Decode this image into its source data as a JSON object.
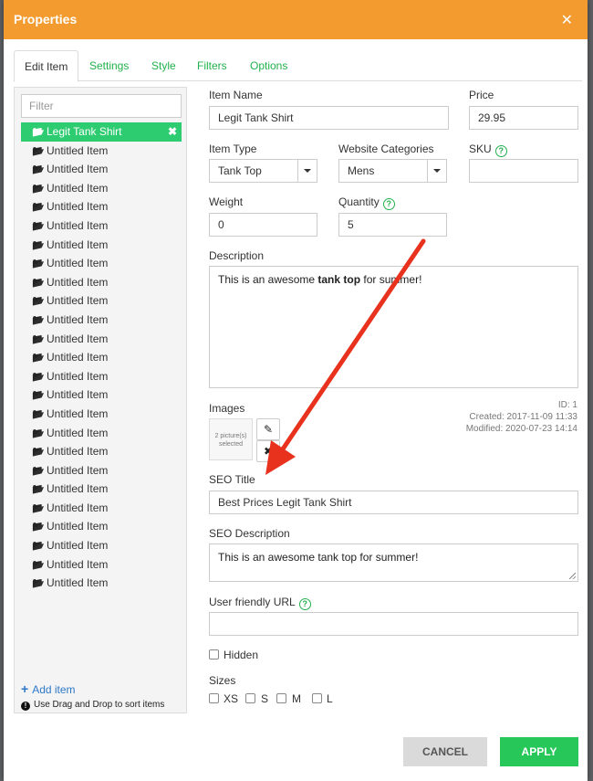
{
  "dialog": {
    "title": "Properties",
    "close_glyph": "✕"
  },
  "tabs": [
    {
      "label": "Edit Item"
    },
    {
      "label": "Settings"
    },
    {
      "label": "Style"
    },
    {
      "label": "Filters"
    },
    {
      "label": "Options"
    }
  ],
  "sidebar": {
    "filter_placeholder": "Filter",
    "items": [
      {
        "label": "Legit Tank Shirt"
      },
      {
        "label": "Untitled Item"
      },
      {
        "label": "Untitled Item"
      },
      {
        "label": "Untitled Item"
      },
      {
        "label": "Untitled Item"
      },
      {
        "label": "Untitled Item"
      },
      {
        "label": "Untitled Item"
      },
      {
        "label": "Untitled Item"
      },
      {
        "label": "Untitled Item"
      },
      {
        "label": "Untitled Item"
      },
      {
        "label": "Untitled Item"
      },
      {
        "label": "Untitled Item"
      },
      {
        "label": "Untitled Item"
      },
      {
        "label": "Untitled Item"
      },
      {
        "label": "Untitled Item"
      },
      {
        "label": "Untitled Item"
      },
      {
        "label": "Untitled Item"
      },
      {
        "label": "Untitled Item"
      },
      {
        "label": "Untitled Item"
      },
      {
        "label": "Untitled Item"
      },
      {
        "label": "Untitled Item"
      },
      {
        "label": "Untitled Item"
      },
      {
        "label": "Untitled Item"
      },
      {
        "label": "Untitled Item"
      },
      {
        "label": "Untitled Item"
      }
    ],
    "add_item_label": "Add item",
    "hint": "Use Drag and Drop to sort items"
  },
  "form": {
    "item_name": {
      "label": "Item Name",
      "value": "Legit Tank Shirt"
    },
    "price": {
      "label": "Price",
      "value": "29.95"
    },
    "item_type": {
      "label": "Item Type",
      "value": "Tank Top"
    },
    "website_categories": {
      "label": "Website Categories",
      "value": "Mens"
    },
    "sku": {
      "label": "SKU",
      "value": ""
    },
    "weight": {
      "label": "Weight",
      "value": "0"
    },
    "quantity": {
      "label": "Quantity",
      "value": "5"
    },
    "description": {
      "label": "Description",
      "before": "This is an awesome ",
      "bold": "tank top",
      "after": " for summer!"
    },
    "images": {
      "label": "Images",
      "thumb_text": "2 picture(s) selected"
    },
    "meta": {
      "id": "ID: 1",
      "created": "Created: 2017-11-09 11:33",
      "modified": "Modified: 2020-07-23 14:14"
    },
    "seo_title": {
      "label": "SEO Title",
      "value": "Best Prices Legit Tank Shirt"
    },
    "seo_description": {
      "label": "SEO Description",
      "value": "This is an awesome tank top for summer!"
    },
    "user_url": {
      "label": "User friendly URL",
      "value": ""
    },
    "hidden": {
      "label": "Hidden",
      "checked": false
    },
    "sizes": {
      "label": "Sizes",
      "options": [
        "XS",
        "S",
        "M",
        "L"
      ]
    },
    "help_glyph": "?"
  },
  "buttons": {
    "cancel": "CANCEL",
    "apply": "APPLY"
  },
  "colors": {
    "title_bar": "#f39b2f",
    "accent_green": "#22b14c",
    "selected_item": "#2ecc71",
    "apply": "#27c75a",
    "arrow": "#e8321e"
  }
}
